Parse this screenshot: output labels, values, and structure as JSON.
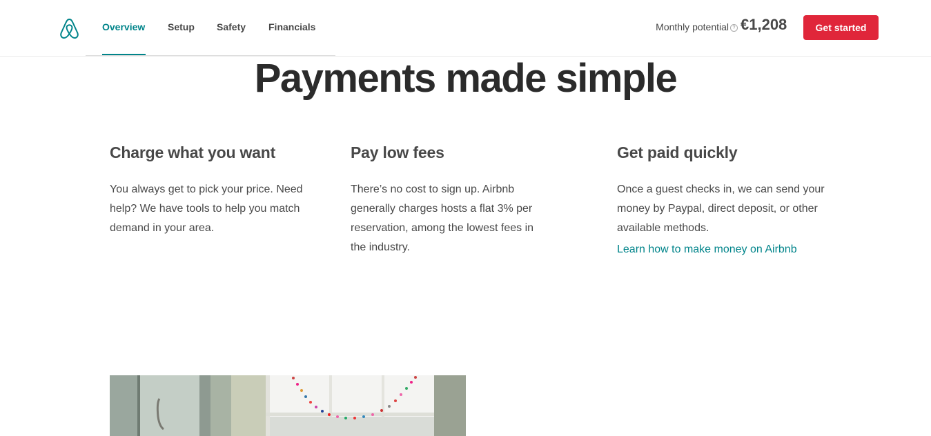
{
  "header": {
    "logo_icon": "airbnb-logo-icon",
    "nav": [
      {
        "label": "Overview",
        "active": true
      },
      {
        "label": "Setup",
        "active": false
      },
      {
        "label": "Safety",
        "active": false
      },
      {
        "label": "Financials",
        "active": false
      }
    ],
    "potential_label": "Monthly potential",
    "potential_amount": "€1,208",
    "cta_label": "Get started"
  },
  "hero": {
    "title": "Payments made simple"
  },
  "features": [
    {
      "heading": "Charge what you want",
      "body": "You always get to pick your price. Need help? We have tools to help you match demand in your area."
    },
    {
      "heading": "Pay low fees",
      "body": "There’s no cost to sign up. Airbnb generally charges hosts a flat 3% per reservation, among the lowest fees in the industry."
    },
    {
      "heading": "Get paid quickly",
      "body": "Once a guest checks in, we can send your money by Paypal, direct deposit, or other available methods.",
      "link": "Learn how to make money on Airbnb"
    }
  ],
  "colors": {
    "accent": "#00848a",
    "cta": "#e0263a",
    "text": "#484848"
  }
}
